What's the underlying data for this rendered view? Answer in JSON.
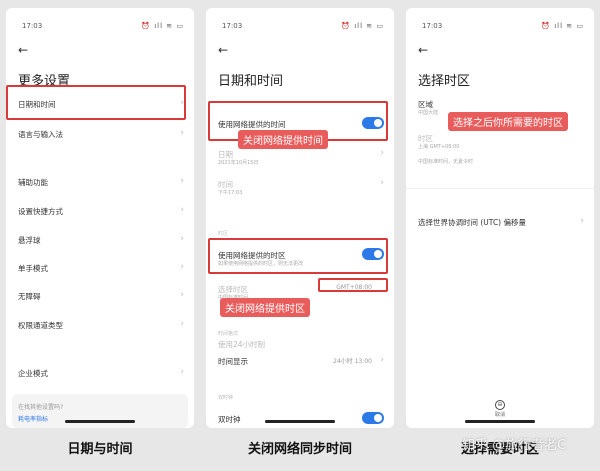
{
  "status": {
    "time": "17:03",
    "icons": "⏰ ıll ≋ ▭"
  },
  "screen1": {
    "title": "更多设置",
    "items": [
      "日期和时间",
      "语言与输入法",
      "辅助功能",
      "设置快捷方式",
      "悬浮球",
      "单手模式",
      "无障碍",
      "权限通道类型",
      "企业模式"
    ],
    "card_text": "在找其他设置吗?",
    "card_link": "耗电率指标"
  },
  "screen2": {
    "title": "日期和时间",
    "auto_time": "使用网络提供的时间",
    "date": "日期",
    "date_sub": "2021年10月15日",
    "time": "时间",
    "time_sub": "下午17:03",
    "section_zone": "时区",
    "auto_zone": "使用网络提供的时区",
    "auto_zone_sub": "如果使用网络提供的时区，则无法更改",
    "zone": "选择时区",
    "zone_sub": "中国标准时间",
    "zone_value": "GMT+08:00",
    "section_format": "时间格式",
    "format_24": "使用24小时制",
    "time_display": "时间显示",
    "time_display_value": "24小时 13:00",
    "section_dual": "双时钟",
    "dual_clock": "双时钟"
  },
  "screen3": {
    "title": "选择时区",
    "region": "区域",
    "region_sub": "中国大陆",
    "zone": "时区",
    "zone_sub": "上海 GMT+08:00",
    "zone_note": "中国标准时间，无夏令时",
    "utc": "选择世界协调时间 (UTC) 偏移量",
    "bottom_btn": "取消",
    "bottom_icon": "⊖"
  },
  "annotations": {
    "close_time": "关闭网络提供时间",
    "close_zone": "关闭网络提供时区",
    "choose_zone": "选择之后你所需要的时区"
  },
  "captions": [
    "日期与时间",
    "关闭网络同步时间",
    "选择需要时区"
  ],
  "watermark": "知乎 @旅行者老C",
  "colors": {
    "accent": "#2b7ae8",
    "highlight": "#d83a3a",
    "tag": "#e85c5c"
  }
}
